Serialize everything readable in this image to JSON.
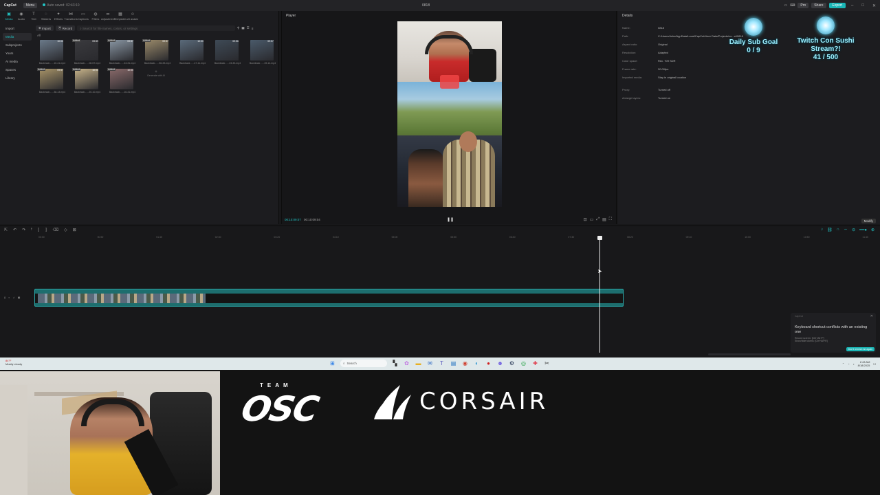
{
  "app": {
    "name": "CapCut",
    "menu_label": "Menu",
    "autosave": "Auto saved: 02:43:10",
    "project_title": "0818",
    "pill1": "Pro",
    "pill2": "Share",
    "export": "Export"
  },
  "toolbar": [
    {
      "icon": "media-icon",
      "glyph": "▣",
      "label": "Media"
    },
    {
      "icon": "audio-icon",
      "glyph": "◉",
      "label": "Audio"
    },
    {
      "icon": "text-icon",
      "glyph": "T",
      "label": "Text"
    },
    {
      "icon": "stickers-icon",
      "glyph": "◌",
      "label": "Stickers"
    },
    {
      "icon": "effects-icon",
      "glyph": "✦",
      "label": "Effects"
    },
    {
      "icon": "transitions-icon",
      "glyph": "⋈",
      "label": "Transitions"
    },
    {
      "icon": "captions-icon",
      "glyph": "▭",
      "label": "Captions"
    },
    {
      "icon": "filters-icon",
      "glyph": "◍",
      "label": "Filters"
    },
    {
      "icon": "adjustment-icon",
      "glyph": "⚌",
      "label": "Adjustment"
    },
    {
      "icon": "templates-icon",
      "glyph": "▦",
      "label": "Templates"
    },
    {
      "icon": "ai-avatar-icon",
      "glyph": "☺",
      "label": "AI avatar"
    }
  ],
  "sidenav": [
    "Import",
    "Media",
    "Subprojects",
    "Yours",
    "AI media",
    "Spaces",
    "Library"
  ],
  "mediabar": {
    "import_label": "Import",
    "record_label": "Record",
    "search_placeholder": "Search for file names, colors, or settings",
    "all_label": "All"
  },
  "media": [
    {
      "dur": "10:00",
      "added": "",
      "name": "Backtrack - ...10-41.mp4",
      "bg": "#6b7a8a"
    },
    {
      "dur": "09:59",
      "added": "Added",
      "name": "Backtrack - ...08-57.mp4",
      "bg": "#3a3a3e"
    },
    {
      "dur": "09:57",
      "added": "Added",
      "name": "Backtrack - ...43-31.mp4",
      "bg": "#8a97a4"
    },
    {
      "dur": "09:57",
      "added": "Added",
      "name": "Backtrack - ...56-33.mp4",
      "bg": "#9a8a6a"
    },
    {
      "dur": "10:00",
      "added": "",
      "name": "Backtrack - ...47-11.mp4",
      "bg": "#5a6a7a"
    },
    {
      "dur": "09:56",
      "added": "",
      "name": "Backtrack - ...23-33.mp4",
      "bg": "#3e4a56"
    },
    {
      "dur": "09:57",
      "added": "",
      "name": "Backtrack - ...49-14.mp4",
      "bg": "#4a5a6a"
    },
    {
      "dur": "09:57",
      "added": "Added",
      "name": "Backtrack - ...38-13.mp4",
      "bg": "#a89468"
    },
    {
      "dur": "10:00",
      "added": "Added",
      "name": "Backtrack - ...20-10.mp4",
      "bg": "#c8b48a"
    },
    {
      "dur": "10:00",
      "added": "Added",
      "name": "Backtrack - ...16-41.mp4",
      "bg": "#8a6a6a"
    }
  ],
  "new_tile": "Generate with AI",
  "player": {
    "header": "Player",
    "time_current": "00:10:09:07",
    "time_total": "00:10:09:04"
  },
  "details": {
    "header": "Details",
    "rows": [
      {
        "k": "Name:",
        "v": "0818"
      },
      {
        "k": "Path:",
        "v": "C:/Users/richo/AppData/Local/CapCut/User Data/Projects/co...ct/0818"
      },
      {
        "k": "Aspect ratio:",
        "v": "Original"
      },
      {
        "k": "Resolution:",
        "v": "Adapted"
      },
      {
        "k": "Color space:",
        "v": "Rec. 709 SDR"
      },
      {
        "k": "Frame rate:",
        "v": "30.00fps"
      },
      {
        "k": "Imported media:",
        "v": "Stay in original location"
      },
      {
        "k": "Proxy:",
        "v": "Turned off"
      },
      {
        "k": "Arrange layers:",
        "v": "Turned on"
      }
    ],
    "modify": "Modify"
  },
  "overlays": {
    "goal1_title": "Daily Sub Goal",
    "goal1_value": "0 / 9",
    "goal2_title": "Twitch Con Sushi Stream?!",
    "goal2_value": "41 / 500"
  },
  "timeline": {
    "ruler": [
      "00:00",
      "00:50",
      "01:40",
      "02:30",
      "03:20",
      "04:10",
      "05:00",
      "05:50",
      "06:40",
      "07:30",
      "08:20",
      "09:10",
      "10:00",
      "10:50",
      "11:40",
      "12:30",
      "13:20"
    ]
  },
  "toast": {
    "brand": "CapCut",
    "title": "Keyboard shortcut conflicts with an existing one",
    "line1": "Record screen: [Ctrl+Alt+P]",
    "line2": "Show/hide tokens: [Ctrl+Alt+R]",
    "button": "Don't remind me again"
  },
  "taskbar": {
    "temp": "84°F",
    "weather": "Mostly cloudy",
    "search": "Search",
    "time": "2:43 AM",
    "date": "8/18/2025"
  },
  "branding": {
    "team": "TEAM",
    "osc": "OSC",
    "corsair": "CORSAIR"
  }
}
